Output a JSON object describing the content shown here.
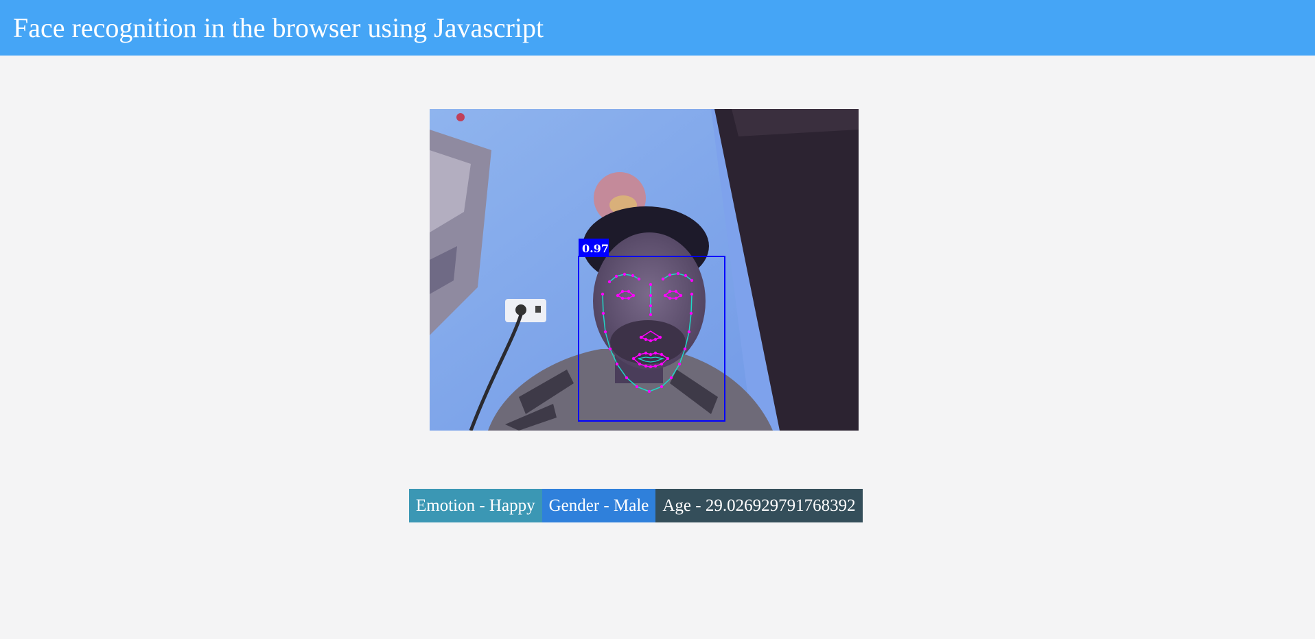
{
  "header": {
    "title": "Face recognition in the browser using Javascript"
  },
  "video": {
    "detection": {
      "score_label": "0.97",
      "box_color": "#0000ff",
      "landmark_color": "#ff00ff",
      "jaw_line_color": "#20d8c8"
    }
  },
  "results": {
    "emotion": "Emotion - Happy",
    "gender": "Gender - Male",
    "age": "Age - 29.026929791768392"
  },
  "colors": {
    "header_bg": "#45a5f6",
    "emotion_bg": "#3b97b4",
    "gender_bg": "#2f80db",
    "age_bg": "#344e5a"
  }
}
